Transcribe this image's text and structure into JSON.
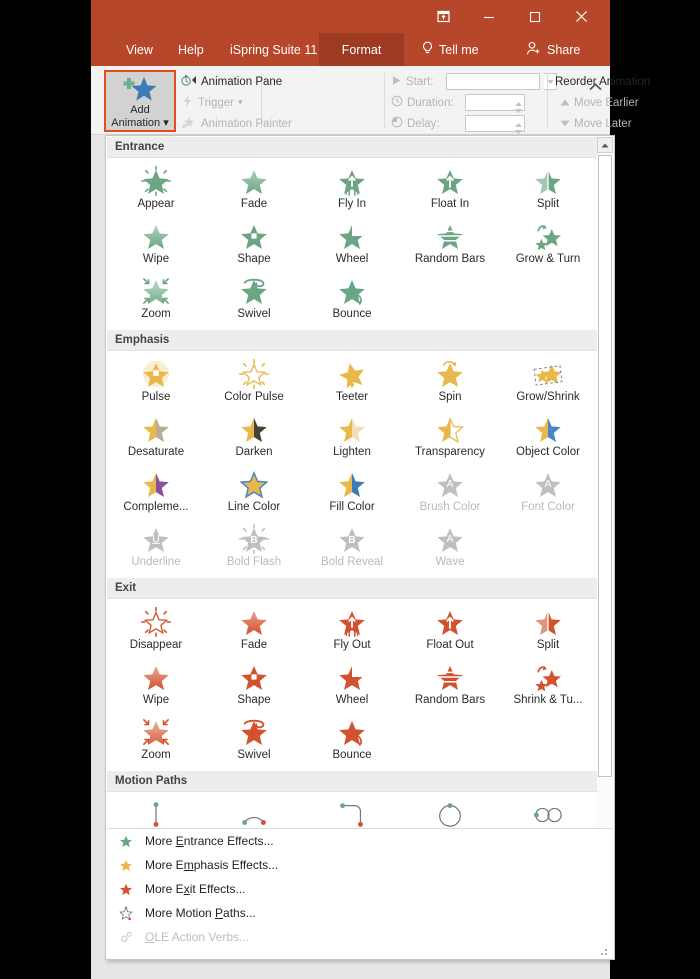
{
  "window": {
    "controls": [
      {
        "name": "ribbon-display-options",
        "glyph": "⊼"
      },
      {
        "name": "minimize",
        "glyph": "—"
      },
      {
        "name": "maximize",
        "glyph": "▢"
      },
      {
        "name": "close",
        "glyph": "✕"
      }
    ]
  },
  "tabs": [
    {
      "label": "View",
      "active": false
    },
    {
      "label": "Help",
      "active": false
    },
    {
      "label": "iSpring Suite 11",
      "active": false
    },
    {
      "label": "Format",
      "active": true
    }
  ],
  "tab_right": {
    "tell_me": "Tell me",
    "share": "Share",
    "tell_me_icon": "lightbulb-icon",
    "share_icon": "share-person-icon"
  },
  "ribbon": {
    "add_animation": {
      "line1": "Add",
      "line2": "Animation",
      "caret": "▾",
      "icon": "add-animation-star-icon"
    },
    "advanced": [
      {
        "label": "Animation Pane",
        "disabled": false,
        "icon": "animation-pane-icon"
      },
      {
        "label": "Trigger",
        "disabled": true,
        "icon": "trigger-bolt-icon",
        "caret": "▾"
      },
      {
        "label": "Animation Painter",
        "disabled": true,
        "icon": "animation-painter-icon"
      }
    ],
    "timing": {
      "start_label": "Start:",
      "start_value": "",
      "duration_label": "Duration:",
      "duration_value": "",
      "delay_label": "Delay:",
      "delay_value": "",
      "start_icon": "play-icon",
      "duration_icon": "clock-icon",
      "delay_icon": "clock-delay-icon"
    },
    "reorder": {
      "title": "Reorder Animation",
      "move_earlier": "Move Earlier",
      "move_later": "Move Later"
    },
    "collapse_icon": "chevron-up-icon"
  },
  "colors": {
    "brand_red": "#b7472a",
    "tab_active": "#9d3a21",
    "entrance_green": "#6ba583",
    "emphasis_gold": "#e8b84b",
    "exit_red": "#d4512e",
    "disabled_gray": "#bfbfbf",
    "highlight_border": "#e24c1e"
  },
  "gallery": {
    "sections": [
      {
        "title": "Entrance",
        "color_key": "entrance_green",
        "items": [
          {
            "label": "Appear",
            "icon": "star-burst-icon",
            "disabled": false
          },
          {
            "label": "Fade",
            "icon": "star-fade-icon",
            "disabled": false
          },
          {
            "label": "Fly In",
            "icon": "star-fly-in-icon",
            "disabled": false
          },
          {
            "label": "Float In",
            "icon": "star-float-in-icon",
            "disabled": false
          },
          {
            "label": "Split",
            "icon": "star-split-icon",
            "disabled": false
          },
          {
            "label": "Wipe",
            "icon": "star-wipe-icon",
            "disabled": false
          },
          {
            "label": "Shape",
            "icon": "star-shape-icon",
            "disabled": false
          },
          {
            "label": "Wheel",
            "icon": "star-wheel-icon",
            "disabled": false
          },
          {
            "label": "Random Bars",
            "icon": "star-random-bars-icon",
            "disabled": false
          },
          {
            "label": "Grow & Turn",
            "icon": "star-grow-turn-icon",
            "disabled": false
          },
          {
            "label": "Zoom",
            "icon": "star-zoom-icon",
            "disabled": false
          },
          {
            "label": "Swivel",
            "icon": "star-swivel-icon",
            "disabled": false
          },
          {
            "label": "Bounce",
            "icon": "star-bounce-icon",
            "disabled": false
          }
        ]
      },
      {
        "title": "Emphasis",
        "color_key": "emphasis_gold",
        "items": [
          {
            "label": "Pulse",
            "icon": "star-pulse-icon",
            "disabled": false
          },
          {
            "label": "Color Pulse",
            "icon": "star-color-pulse-icon",
            "disabled": false
          },
          {
            "label": "Teeter",
            "icon": "star-teeter-icon",
            "disabled": false
          },
          {
            "label": "Spin",
            "icon": "star-spin-icon",
            "disabled": false
          },
          {
            "label": "Grow/Shrink",
            "icon": "star-grow-shrink-icon",
            "disabled": false
          },
          {
            "label": "Desaturate",
            "icon": "star-desaturate-icon",
            "disabled": false
          },
          {
            "label": "Darken",
            "icon": "star-darken-icon",
            "disabled": false
          },
          {
            "label": "Lighten",
            "icon": "star-lighten-icon",
            "disabled": false
          },
          {
            "label": "Transparency",
            "icon": "star-transparency-icon",
            "disabled": false
          },
          {
            "label": "Object Color",
            "icon": "star-object-color-icon",
            "disabled": false
          },
          {
            "label": "Compleme...",
            "icon": "star-complementary-color-icon",
            "disabled": false
          },
          {
            "label": "Line Color",
            "icon": "star-line-color-icon",
            "disabled": false
          },
          {
            "label": "Fill Color",
            "icon": "star-fill-color-icon",
            "disabled": false
          },
          {
            "label": "Brush Color",
            "icon": "star-brush-color-icon",
            "disabled": true
          },
          {
            "label": "Font Color",
            "icon": "star-font-color-icon",
            "disabled": true
          },
          {
            "label": "Underline",
            "icon": "star-underline-icon",
            "disabled": true
          },
          {
            "label": "Bold Flash",
            "icon": "star-bold-flash-icon",
            "disabled": true
          },
          {
            "label": "Bold Reveal",
            "icon": "star-bold-reveal-icon",
            "disabled": true
          },
          {
            "label": "Wave",
            "icon": "star-wave-icon",
            "disabled": true
          }
        ]
      },
      {
        "title": "Exit",
        "color_key": "exit_red",
        "items": [
          {
            "label": "Disappear",
            "icon": "star-disappear-icon",
            "disabled": false
          },
          {
            "label": "Fade",
            "icon": "star-fade-icon",
            "disabled": false
          },
          {
            "label": "Fly Out",
            "icon": "star-fly-out-icon",
            "disabled": false
          },
          {
            "label": "Float Out",
            "icon": "star-float-out-icon",
            "disabled": false
          },
          {
            "label": "Split",
            "icon": "star-split-icon",
            "disabled": false
          },
          {
            "label": "Wipe",
            "icon": "star-wipe-icon",
            "disabled": false
          },
          {
            "label": "Shape",
            "icon": "star-shape-icon",
            "disabled": false
          },
          {
            "label": "Wheel",
            "icon": "star-wheel-icon",
            "disabled": false
          },
          {
            "label": "Random Bars",
            "icon": "star-random-bars-icon",
            "disabled": false
          },
          {
            "label": "Shrink & Tu...",
            "icon": "star-shrink-turn-icon",
            "disabled": false
          },
          {
            "label": "Zoom",
            "icon": "star-zoom-icon",
            "disabled": false
          },
          {
            "label": "Swivel",
            "icon": "star-swivel-icon",
            "disabled": false
          },
          {
            "label": "Bounce",
            "icon": "star-bounce-icon",
            "disabled": false
          }
        ]
      },
      {
        "title": "Motion Paths",
        "color_key": "entrance_green",
        "items": [
          {
            "label": "Lines",
            "icon": "path-lines-icon",
            "disabled": false
          },
          {
            "label": "Arcs",
            "icon": "path-arcs-icon",
            "disabled": false
          },
          {
            "label": "Turns",
            "icon": "path-turns-icon",
            "disabled": false
          },
          {
            "label": "Shapes",
            "icon": "path-shapes-icon",
            "disabled": false
          },
          {
            "label": "Loops",
            "icon": "path-loops-icon",
            "disabled": false
          }
        ]
      }
    ],
    "commands": [
      {
        "pre": "More ",
        "key": "E",
        "post": "ntrance Effects...",
        "icon": "star-green-icon",
        "disabled": false
      },
      {
        "pre": "More E",
        "key": "m",
        "post": "phasis Effects...",
        "icon": "star-gold-icon",
        "disabled": false
      },
      {
        "pre": "More E",
        "key": "x",
        "post": "it Effects...",
        "icon": "star-red-icon",
        "disabled": false
      },
      {
        "pre": "More Motion ",
        "key": "P",
        "post": "aths...",
        "icon": "star-outline-path-icon",
        "disabled": false
      },
      {
        "pre": "",
        "key": "O",
        "post": "LE Action Verbs...",
        "icon": "gears-icon",
        "disabled": true
      }
    ],
    "scroll_up_icon": "scroll-up-arrow-icon",
    "scroll_down_icon": "scroll-down-arrow-icon"
  }
}
